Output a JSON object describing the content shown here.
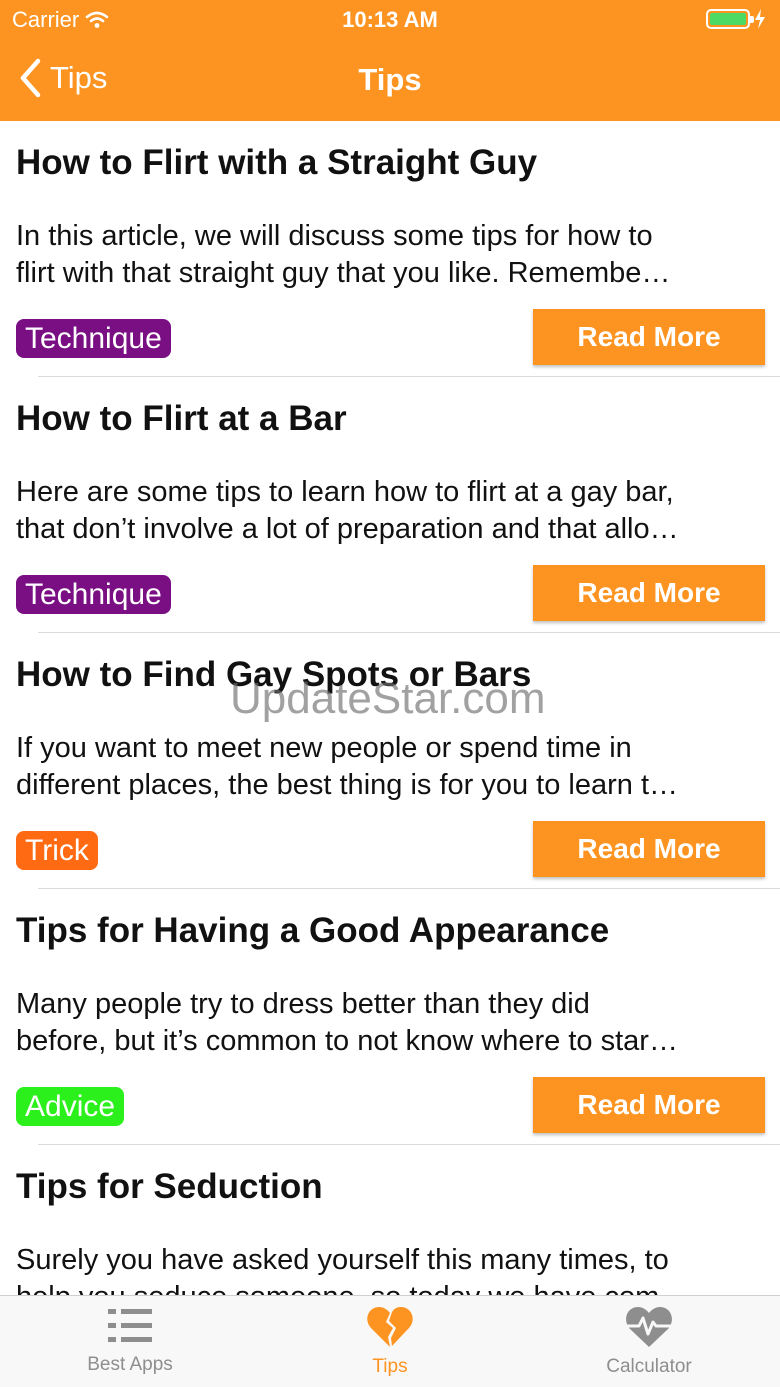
{
  "status_bar": {
    "carrier": "Carrier",
    "time": "10:13 AM"
  },
  "nav": {
    "back_label": "Tips",
    "title": "Tips"
  },
  "articles": [
    {
      "title": "How to Flirt with a Straight Guy",
      "desc_line1": "In this article, we will discuss some tips for how to",
      "desc_line2": "flirt with that straight guy that you like.  Remembe…",
      "tag": "Technique",
      "read_more": "Read More"
    },
    {
      "title": "How to Flirt at a Bar",
      "desc_line1": "Here are some tips to learn how to flirt at a gay bar,",
      "desc_line2": "that don’t involve a lot of preparation and that allo…",
      "tag": "Technique",
      "read_more": "Read More"
    },
    {
      "title": "How to Find Gay Spots or Bars",
      "desc_line1": "If you want to meet new people or spend time in",
      "desc_line2": "different places, the best thing is for you to learn t…",
      "tag": "Trick",
      "read_more": "Read More"
    },
    {
      "title": "Tips for Having a Good Appearance",
      "desc_line1": "Many people try to dress better than they did",
      "desc_line2": "before, but it’s common to not know where to star…",
      "tag": "Advice",
      "read_more": "Read More"
    },
    {
      "title": "Tips for Seduction",
      "desc_line1": "Surely you have asked yourself this many times, to",
      "desc_line2": "help you seduce someone, so today we have com…",
      "tag": "",
      "read_more": ""
    }
  ],
  "tag_colors": {
    "Technique": "#7a0f84",
    "Trick": "#ff6a13",
    "Advice": "#2bf01c"
  },
  "accent_color": "#fd9421",
  "watermark": "UpdateStar.com",
  "tabbar": {
    "tabs": [
      {
        "label": "Best Apps",
        "icon": "list-icon",
        "active": false
      },
      {
        "label": "Tips",
        "icon": "broken-heart-icon",
        "active": true
      },
      {
        "label": "Calculator",
        "icon": "heartbeat-icon",
        "active": false
      }
    ]
  }
}
